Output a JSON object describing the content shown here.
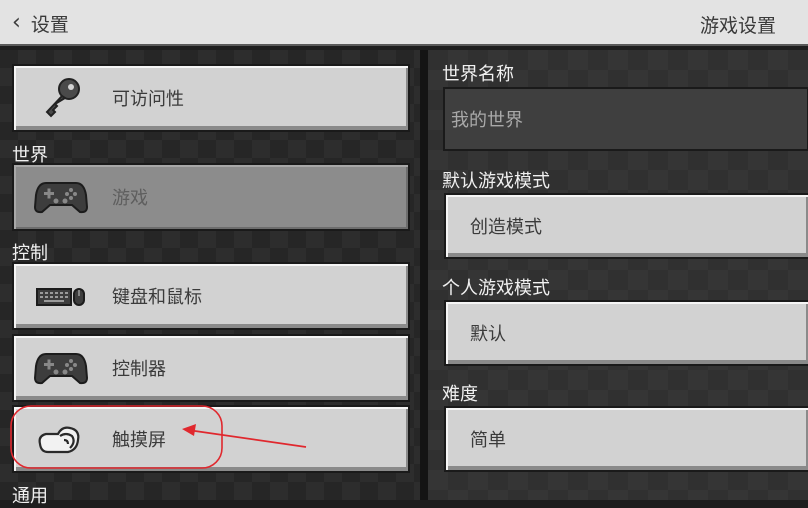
{
  "header": {
    "back_label": "设置",
    "title": "游戏设置"
  },
  "sidebar": {
    "items": [
      {
        "label": "可访问性",
        "icon": "key-icon"
      },
      {
        "section": "世界"
      },
      {
        "label": "游戏",
        "icon": "gamepad-icon",
        "selected": true
      },
      {
        "section": "控制"
      },
      {
        "label": "键盘和鼠标",
        "icon": "keyboard-mouse-icon"
      },
      {
        "label": "控制器",
        "icon": "controller-icon"
      },
      {
        "label": "触摸屏",
        "icon": "touch-hand-icon"
      },
      {
        "section": "通用"
      }
    ]
  },
  "main": {
    "world_name": {
      "label": "世界名称",
      "placeholder": "我的世界"
    },
    "default_mode": {
      "label": "默认游戏模式",
      "value": "创造模式"
    },
    "personal_mode": {
      "label": "个人游戏模式",
      "value": "默认"
    },
    "difficulty": {
      "label": "难度",
      "value": "简单"
    }
  },
  "colors": {
    "annotation": "#e0282e",
    "panel_button": "#d2d2d2",
    "selected_button": "#8c8c8c"
  }
}
